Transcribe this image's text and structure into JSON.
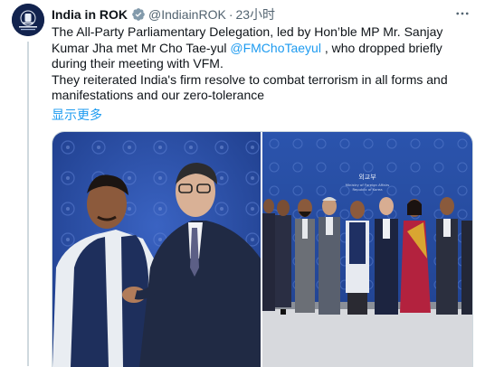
{
  "tweet": {
    "author_name": "India in ROK",
    "handle": "@IndiainROK",
    "separator": "·",
    "time": "23小时",
    "text_line1_before": "The All-Party Parliamentary Delegation, led by Hon’ble MP Mr. Sanjay Kumar Jha met Mr Cho Tae-yul ",
    "mention": "@FMChoTaeyul",
    "text_line1_after": " , who dropped briefly during their meeting with VFM.",
    "text_line2": "They reiterated India's firm resolve to combat terrorism in all forms and manifestations and our zero-tolerance",
    "show_more": "显示更多"
  },
  "icons": {
    "verified": "verified-badge-icon",
    "more": "more-options-icon"
  },
  "media": {
    "photo_count": 2,
    "backdrop_sign_lines": [
      "외교부",
      "Ministry of Foreign Affairs",
      "Republic of Korea"
    ]
  },
  "colors": {
    "accent": "#1d9bf0",
    "text_primary": "#0f1419",
    "text_secondary": "#536471",
    "border": "#cfd9de",
    "backdrop_blue": "#2a4fa6"
  }
}
